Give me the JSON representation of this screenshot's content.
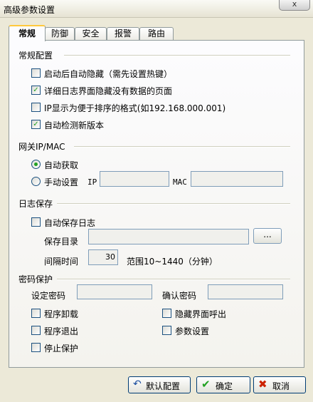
{
  "window": {
    "title": "高级参数设置",
    "close_label": "x"
  },
  "tabs": [
    "常规",
    "防御",
    "安全",
    "报警",
    "路由"
  ],
  "general": {
    "section_title": "常规配置",
    "options": [
      {
        "label": "启动后自动隐藏（需先设置热键）",
        "checked": false
      },
      {
        "label": "详细日志界面隐藏没有数据的页面",
        "checked": true
      },
      {
        "label": "IP显示为便于排序的格式(如192.168.000.001)",
        "checked": false
      },
      {
        "label": "自动检测新版本",
        "checked": true
      }
    ]
  },
  "gateway": {
    "section_title": "网关IP/MAC",
    "auto_label": "自动获取",
    "manual_label": "手动设置",
    "selected": "auto",
    "ip_label": "IP",
    "mac_label": "MAC",
    "ip_value": "",
    "mac_value": ""
  },
  "log": {
    "section_title": "日志保存",
    "auto_save_label": "自动保存日志",
    "auto_save_checked": false,
    "dir_label": "保存目录",
    "dir_value": "",
    "browse_label": "...",
    "interval_label": "间隔时间",
    "interval_value": "30",
    "range_text": "范围10~1440（分钟）"
  },
  "password": {
    "section_title": "密码保护",
    "set_label": "设定密码",
    "confirm_label": "确认密码",
    "set_value": "",
    "confirm_value": "",
    "left_options": [
      {
        "label": "程序卸载",
        "checked": false
      },
      {
        "label": "程序退出",
        "checked": false
      },
      {
        "label": "停止保护",
        "checked": false
      }
    ],
    "right_options": [
      {
        "label": "隐藏界面呼出",
        "checked": false
      },
      {
        "label": "参数设置",
        "checked": false
      }
    ]
  },
  "buttons": {
    "default_label": "默认配置",
    "ok_label": "确定",
    "cancel_label": "取消"
  },
  "colors": {
    "check": "#21a121",
    "tab_highlight": "#ffc83c",
    "cancel_icon": "#cc2200",
    "default_icon": "#1c4fa0"
  }
}
